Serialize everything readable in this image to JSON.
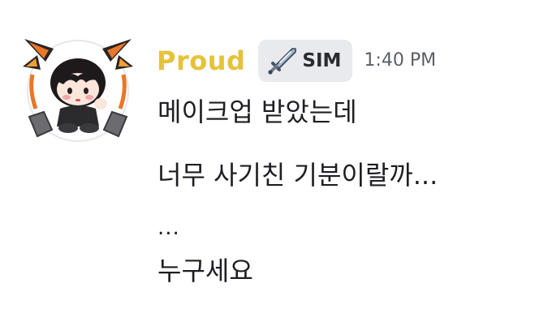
{
  "message": {
    "author": {
      "username": "Proud",
      "username_color": "#e6c23a",
      "avatar_icon": "chibi-character-avatar-icon"
    },
    "tag": {
      "icon": "sword-icon",
      "label": "SIM"
    },
    "timestamp": "1:40 PM",
    "lines": [
      "메이크업 받았는데",
      "너무 사기친 기분이랄까...",
      "...",
      "누구세요"
    ]
  }
}
